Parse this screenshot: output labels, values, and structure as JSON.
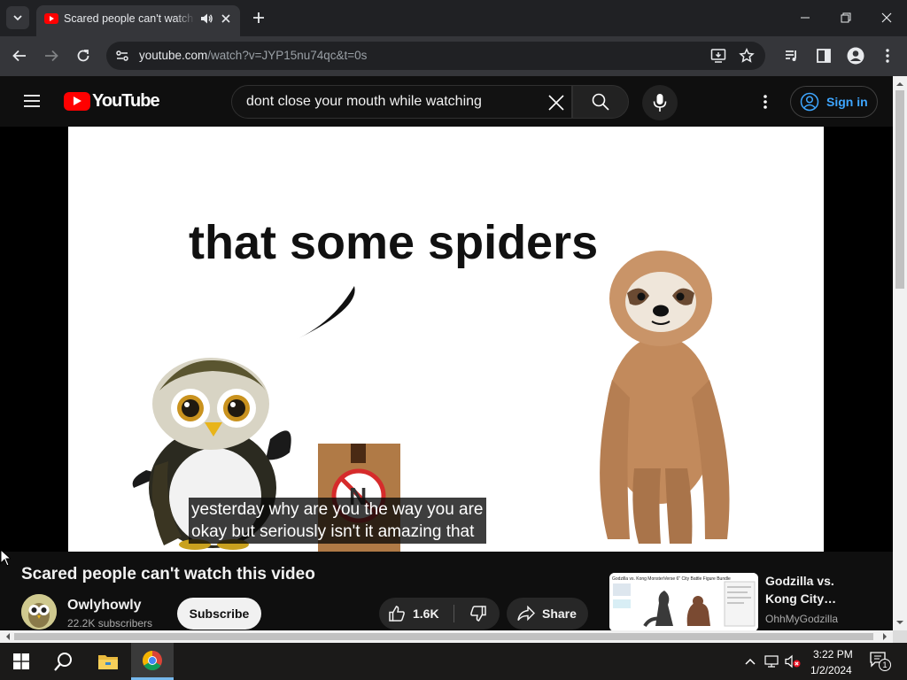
{
  "browser": {
    "tab_title": "Scared people can't watch this video",
    "url_host": "youtube.com",
    "url_path": "/watch?v=JYP15nu74qc&t=0s"
  },
  "youtube": {
    "logo_text": "YouTube",
    "search_query": "dont close your mouth while watching",
    "sign_in_label": "Sign in"
  },
  "video": {
    "on_screen_text": "that some spiders",
    "box_label": "N",
    "subtitles": [
      "yesterday why are you the way you are",
      "okay but seriously isn't it amazing that"
    ],
    "title": "Scared people can't watch this video",
    "channel_name": "Owlyhowly",
    "subscriber_count": "22.2K subscribers",
    "subscribe_label": "Subscribe",
    "like_count": "1.6K",
    "share_label": "Share"
  },
  "recommendation": {
    "title": "Godzilla vs. Kong City…",
    "channel": "OhhMyGodzilla",
    "thumb_caption": "Godzilla vs. Kong MonsterVerse 6\" City Battle Figure Bundle"
  },
  "taskbar": {
    "time": "3:22 PM",
    "date": "1/2/2024",
    "notification_count": "1"
  },
  "colors": {
    "youtube_red": "#ff0000",
    "link_blue": "#3ea6ff",
    "page_bg": "#0f0f0f"
  }
}
